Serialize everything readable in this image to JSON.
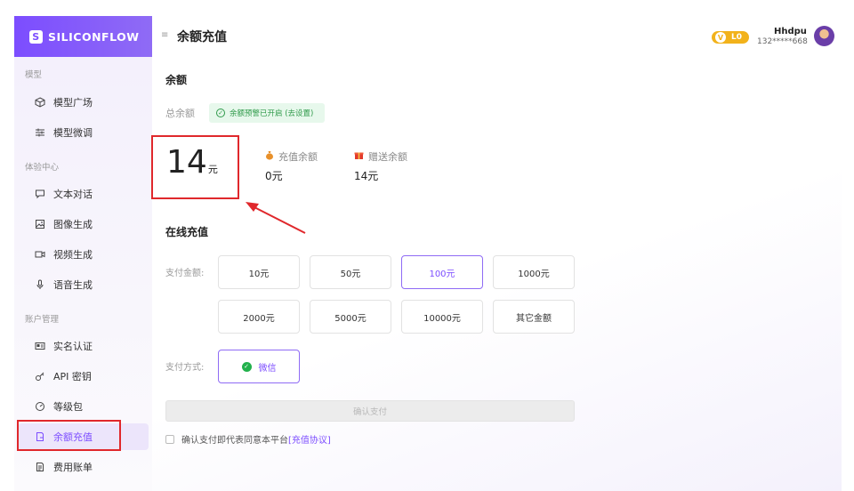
{
  "brand": {
    "logo_text": "SILICONFLOW",
    "logo_mark": "S"
  },
  "sidebar": {
    "sections": [
      {
        "label": "模型"
      },
      {
        "label": "体验中心"
      },
      {
        "label": "账户管理"
      }
    ],
    "items": [
      {
        "label": "模型广场",
        "icon": "cube-icon"
      },
      {
        "label": "模型微调",
        "icon": "sliders-icon"
      },
      {
        "label": "文本对话",
        "icon": "chat-icon"
      },
      {
        "label": "图像生成",
        "icon": "image-icon"
      },
      {
        "label": "视频生成",
        "icon": "video-icon"
      },
      {
        "label": "语音生成",
        "icon": "mic-icon"
      },
      {
        "label": "实名认证",
        "icon": "id-card-icon"
      },
      {
        "label": "API 密钥",
        "icon": "key-icon"
      },
      {
        "label": "等级包",
        "icon": "gauge-icon"
      },
      {
        "label": "余额充值",
        "icon": "wallet-icon",
        "active": true
      },
      {
        "label": "费用账单",
        "icon": "bill-icon"
      }
    ]
  },
  "header": {
    "menu_icon": "≡",
    "title": "余额充值",
    "level_badge": "L0",
    "level_icon_glyph": "V",
    "username": "Hhdpu",
    "phone": "132*****668"
  },
  "balance": {
    "heading": "余额",
    "total_label": "总余额",
    "alert_text": "余额预警已开启 (去设置)",
    "alert_check": "✓",
    "total_value": "14",
    "total_unit": "元",
    "recharge_label": "充值余额",
    "recharge_value": "0元",
    "gift_label": "赠送余额",
    "gift_value": "14元"
  },
  "online": {
    "heading": "在线充值",
    "amount_label": "支付金额:",
    "amounts": [
      {
        "label": "10元"
      },
      {
        "label": "50元"
      },
      {
        "label": "100元",
        "selected": true
      },
      {
        "label": "1000元"
      },
      {
        "label": "2000元"
      },
      {
        "label": "5000元"
      },
      {
        "label": "10000元"
      },
      {
        "label": "其它金额"
      }
    ],
    "method_label": "支付方式:",
    "method_option": "微信",
    "method_check": "✓",
    "confirm_label": "确认支付",
    "agree_text": "确认支付即代表同意本平台",
    "agree_link": "[充值协议]"
  },
  "colors": {
    "accent": "#7c4dff",
    "annotation_red": "#e0282c",
    "badge_gold": "#f2b21b",
    "success_green": "#2f9a4a"
  }
}
